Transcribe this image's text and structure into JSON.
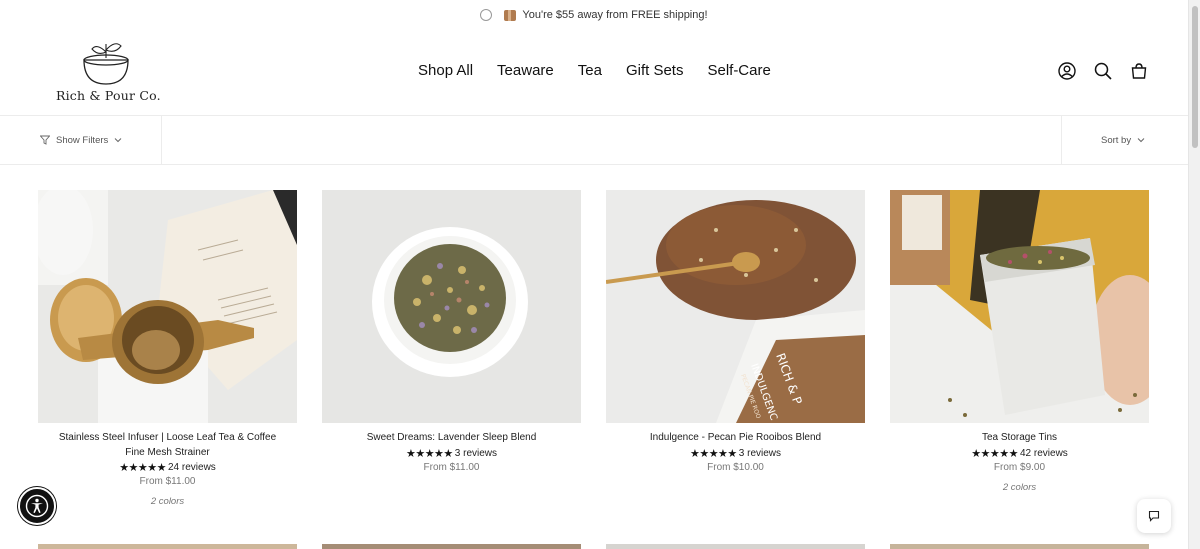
{
  "announcement": {
    "text": "You're $55 away from FREE shipping!"
  },
  "brand": {
    "name": "Rich & Pour Co."
  },
  "nav": [
    "Shop All",
    "Teaware",
    "Tea",
    "Gift Sets",
    "Self-Care"
  ],
  "header_icons": [
    "account-icon",
    "search-icon",
    "cart-icon"
  ],
  "filters": {
    "show_filters": "Show Filters",
    "sort_by": "Sort by"
  },
  "products": [
    {
      "title": "Stainless Steel Infuser | Loose Leaf Tea & Coffee Fine Mesh Strainer",
      "stars": "★★★★★",
      "reviews": "24 reviews",
      "price": "From $11.00",
      "colors": "2 colors"
    },
    {
      "title": "Sweet Dreams: Lavender Sleep Blend",
      "stars": "★★★★★",
      "reviews": "3 reviews",
      "price": "From $11.00",
      "colors": ""
    },
    {
      "title": "Indulgence - Pecan Pie Rooibos Blend",
      "stars": "★★★★★",
      "reviews": "3 reviews",
      "price": "From $10.00",
      "colors": ""
    },
    {
      "title": "Tea Storage Tins",
      "stars": "★★★★★",
      "reviews": "42 reviews",
      "price": "From $9.00",
      "colors": "2 colors"
    }
  ],
  "image_text": {
    "bag_brand": "RICH & P",
    "bag_name": "INDULGENC",
    "bag_sub": "PECAN PIE ROO"
  },
  "colors": {
    "gold": "#c99a4f",
    "tea_brown": "#6b4a2a",
    "bag_brown": "#9a6c45"
  }
}
